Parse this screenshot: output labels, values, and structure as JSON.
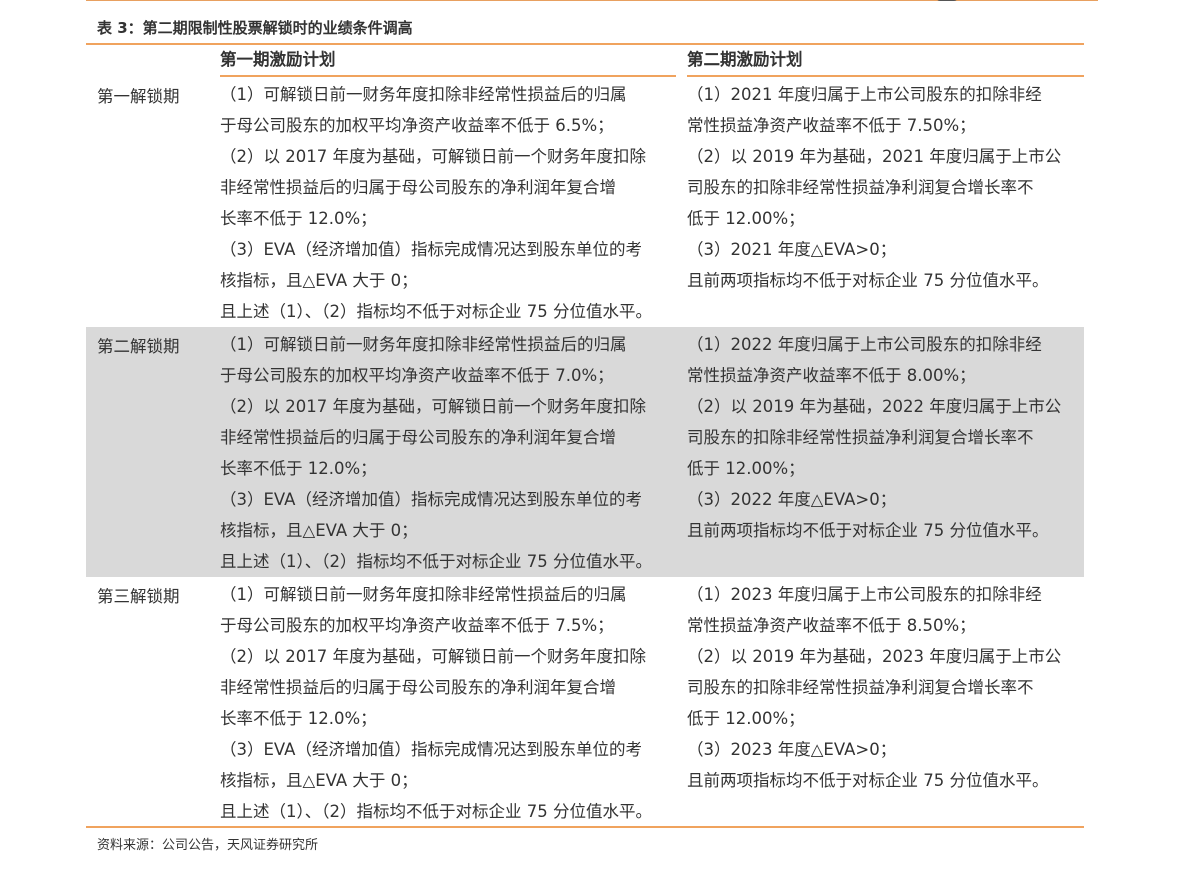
{
  "caption": "表 3：第二期限制性股票解锁时的业绩条件调高",
  "header": {
    "col1": "第一期激励计划",
    "col2": "第二期激励计划"
  },
  "rows": [
    {
      "label": "第一解锁期",
      "col1": [
        "（1）可解锁日前一财务年度扣除非经常性损益后的归属",
        "于母公司股东的加权平均净资产收益率不低于 6.5%；",
        "（2）以 2017 年度为基础，可解锁日前一个财务年度扣除",
        "非经常性损益后的归属于母公司股东的净利润年复合增",
        "长率不低于 12.0%；",
        "（3）EVA（经济增加值）指标完成情况达到股东单位的考",
        "核指标，且△EVA  大于 0；",
        "且上述（1）、（2）指标均不低于对标企业 75 分位值水平。"
      ],
      "col2": [
        "（1）2021 年度归属于上市公司股东的扣除非经",
        "常性损益净资产收益率不低于 7.50%；",
        "（2）以 2019 年为基础，2021 年度归属于上市公",
        "司股东的扣除非经常性损益净利润复合增长率不",
        "低于 12.00%；",
        "（3）2021 年度△EVA>0；",
        "且前两项指标均不低于对标企业 75 分位值水平。"
      ]
    },
    {
      "label": "第二解锁期",
      "col1": [
        "（1）可解锁日前一财务年度扣除非经常性损益后的归属",
        "于母公司股东的加权平均净资产收益率不低于 7.0%；",
        "（2）以 2017 年度为基础，可解锁日前一个财务年度扣除",
        "非经常性损益后的归属于母公司股东的净利润年复合增",
        "长率不低于 12.0%；",
        "（3）EVA（经济增加值）指标完成情况达到股东单位的考",
        "核指标，且△EVA  大于 0；",
        "且上述（1）、（2）指标均不低于对标企业 75 分位值水平。"
      ],
      "col2": [
        "（1）2022 年度归属于上市公司股东的扣除非经",
        "常性损益净资产收益率不低于 8.00%；",
        "（2）以 2019 年为基础，2022 年度归属于上市公",
        "司股东的扣除非经常性损益净利润复合增长率不",
        "低于 12.00%；",
        "（3）2022 年度△EVA>0；",
        "且前两项指标均不低于对标企业 75 分位值水平。"
      ]
    },
    {
      "label": "第三解锁期",
      "col1": [
        "（1）可解锁日前一财务年度扣除非经常性损益后的归属",
        "于母公司股东的加权平均净资产收益率不低于 7.5%；",
        "（2）以 2017 年度为基础，可解锁日前一个财务年度扣除",
        "非经常性损益后的归属于母公司股东的净利润年复合增",
        "长率不低于 12.0%；",
        "（3）EVA（经济增加值）指标完成情况达到股东单位的考",
        "核指标，且△EVA  大于 0；",
        "且上述（1）、（2）指标均不低于对标企业 75 分位值水平。"
      ],
      "col2": [
        "（1）2023 年度归属于上市公司股东的扣除非经",
        "常性损益净资产收益率不低于 8.50%；",
        "（2）以 2019 年为基础，2023 年度归属于上市公",
        "司股东的扣除非经常性损益净利润复合增长率不",
        "低于 12.00%；",
        "（3）2023 年度△EVA>0；",
        "且前两项指标均不低于对标企业 75 分位值水平。"
      ]
    }
  ],
  "source": "资料来源：公司公告，天风证券研究所",
  "colors": {
    "accent": "#f0a35e",
    "shaded_row": "#d9d9d9",
    "text": "#333333"
  }
}
